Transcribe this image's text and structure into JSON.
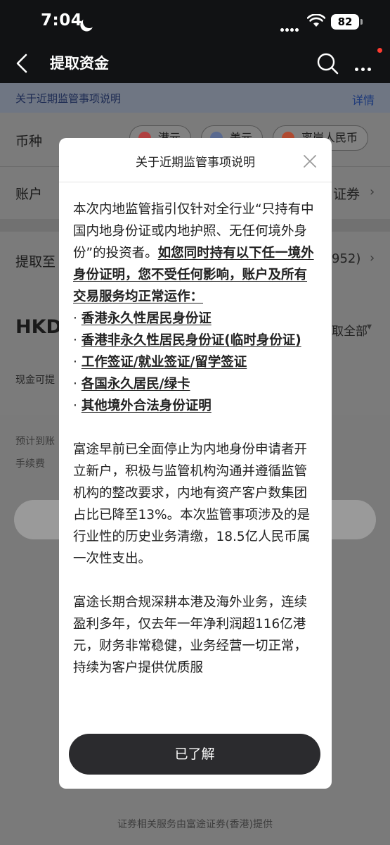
{
  "status_bar": {
    "time": "7:04",
    "battery": "82"
  },
  "nav": {
    "title": "提取资金"
  },
  "notice": {
    "text": "关于近期监管事项说明",
    "link": "详情"
  },
  "form": {
    "currency_label": "币种",
    "currencies": [
      "港元",
      "美元",
      "离岸人民币"
    ],
    "account_label": "账户",
    "account_value": "证券",
    "withdraw_to_label": "提取至",
    "withdraw_to_value": "952)",
    "amount_currency": "HKD",
    "withdraw_all": "取全部",
    "cash_available_label": "现金可提",
    "eta_label": "预计到账",
    "fee_label": "手续费"
  },
  "footer": {
    "note": "证券相关服务由富途证券(香港)提供"
  },
  "modal": {
    "title": "关于近期监管事项说明",
    "para1_intro": "本次内地监管指引仅针对全行业“只持有中国内地身份证或内地护照、无任何境外身份”的投资者。",
    "para1_emph": "如您同时持有以下任一境外身份证明，您不受任何影响，账户及所有交易服务均正常运作：",
    "bullets": [
      "香港永久性居民身份证",
      "香港非永久性居民身份证(临时身份证)",
      "工作签证/就业签证/留学签证",
      "各国永久居民/绿卡",
      "其他境外合法身份证明"
    ],
    "para2": "富途早前已全面停止为内地身份申请者开立新户，积极与监管机构沟通并遵循监管机构的整改要求，内地有资产客户数集团占比已降至13%。本次监管事项涉及的是行业性的历史业务清缴，18.5亿人民币属一次性支出。",
    "para3": "富途长期合规深耕本港及海外业务，连续盈利多年，仅去年一年净利润超116亿港元，财务非常稳健，业务经营一切正常，持续为客户提供优质服",
    "ok_button": "已了解"
  },
  "colors": {
    "overlay_dim": "#7a7a7a",
    "header_bg": "#111214",
    "button_dark": "#2b2b2e"
  }
}
